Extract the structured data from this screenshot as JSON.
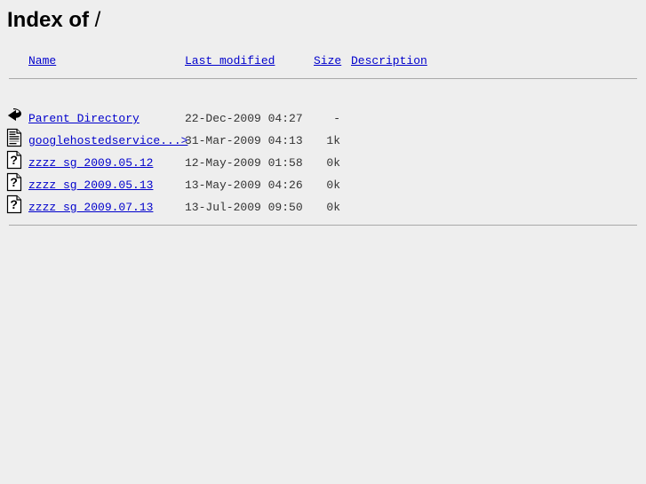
{
  "page": {
    "title_bold": "Index of",
    "title_path": " /",
    "background_color": "#eeeeee",
    "link_color": "#0000cc",
    "rule_color": "#a9a9a9"
  },
  "columns": {
    "name": "Name",
    "last_modified": "Last modified",
    "size": "Size",
    "description": "Description"
  },
  "entries": [
    {
      "icon": "parent-directory-icon",
      "name": "Parent Directory",
      "last_modified": "22-Dec-2009 04:27",
      "size": "-",
      "description": ""
    },
    {
      "icon": "text-file-icon",
      "name": "googlehostedservice...>",
      "last_modified": "31-Mar-2009 04:13",
      "size": "1k",
      "description": ""
    },
    {
      "icon": "unknown-file-icon",
      "name": "zzzz_sg_2009.05.12",
      "last_modified": "12-May-2009 01:58",
      "size": "0k",
      "description": ""
    },
    {
      "icon": "unknown-file-icon",
      "name": "zzzz_sg_2009.05.13",
      "last_modified": "13-May-2009 04:26",
      "size": "0k",
      "description": ""
    },
    {
      "icon": "unknown-file-icon",
      "name": "zzzz_sg_2009.07.13",
      "last_modified": "13-Jul-2009 09:50",
      "size": "0k",
      "description": ""
    }
  ]
}
